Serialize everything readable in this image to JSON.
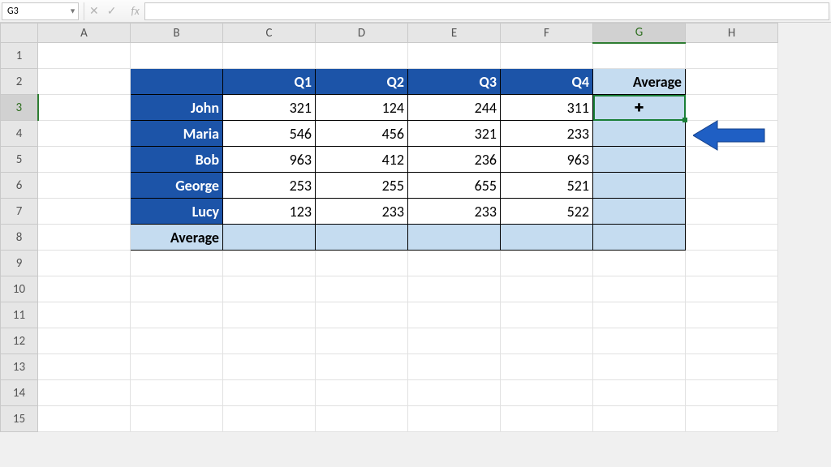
{
  "toolbar": {
    "name_box_value": "G3",
    "formula_value": ""
  },
  "columns": [
    "A",
    "B",
    "C",
    "D",
    "E",
    "F",
    "G",
    "H"
  ],
  "row_count": 15,
  "selected_cell": {
    "col": "G",
    "row": 3
  },
  "table": {
    "header": {
      "blank": "",
      "q1": "Q1",
      "q2": "Q2",
      "q3": "Q3",
      "q4": "Q4",
      "avg": "Average"
    },
    "rows": [
      {
        "name": "John",
        "q1": "321",
        "q2": "124",
        "q3": "244",
        "q4": "311"
      },
      {
        "name": "Maria",
        "q1": "546",
        "q2": "456",
        "q3": "321",
        "q4": "233"
      },
      {
        "name": "Bob",
        "q1": "963",
        "q2": "412",
        "q3": "236",
        "q4": "963"
      },
      {
        "name": "George",
        "q1": "253",
        "q2": "255",
        "q3": "655",
        "q4": "521"
      },
      {
        "name": "Lucy",
        "q1": "123",
        "q2": "233",
        "q3": "233",
        "q4": "522"
      }
    ],
    "footer": {
      "label": "Average"
    }
  },
  "fx_label": "fx",
  "chart_data": {
    "type": "table",
    "categories": [
      "Q1",
      "Q2",
      "Q3",
      "Q4"
    ],
    "series": [
      {
        "name": "John",
        "values": [
          321,
          124,
          244,
          311
        ]
      },
      {
        "name": "Maria",
        "values": [
          546,
          456,
          321,
          233
        ]
      },
      {
        "name": "Bob",
        "values": [
          963,
          412,
          236,
          963
        ]
      },
      {
        "name": "George",
        "values": [
          253,
          255,
          655,
          521
        ]
      },
      {
        "name": "Lucy",
        "values": [
          123,
          233,
          233,
          522
        ]
      }
    ],
    "title": "",
    "xlabel": "",
    "ylabel": ""
  }
}
